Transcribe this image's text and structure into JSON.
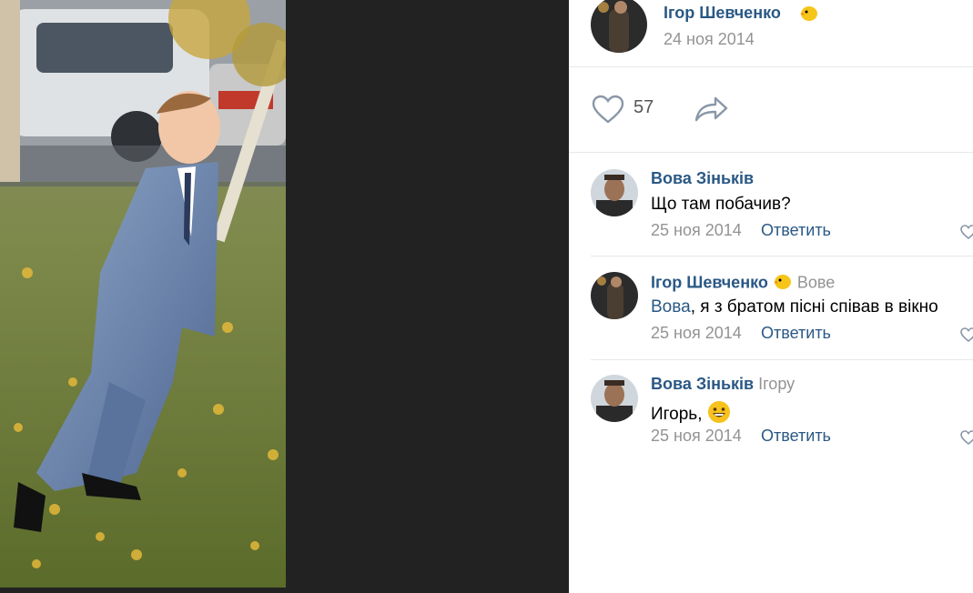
{
  "post": {
    "author": "Ігор Шевченко",
    "author_badge_icon": "chick-emoji-icon",
    "date": "24 ноя 2014",
    "likes": "57"
  },
  "comments": [
    {
      "author": "Вова Зіньків",
      "text": "Що там побачив?",
      "date": "25 ноя 2014",
      "reply_label": "Ответить"
    },
    {
      "author": "Ігор Шевченко",
      "reply_to": "Вове",
      "mention": "Вова",
      "text": ", я з братом пісні співав в вікно",
      "date": "25 ноя 2014",
      "reply_label": "Ответить"
    },
    {
      "author": "Вова Зіньків",
      "reply_to": "Ігору",
      "text": "Игорь, ",
      "emoji_icon": "grinning-face-emoji-icon",
      "date": "25 ноя 2014",
      "reply_label": "Ответить"
    }
  ],
  "colors": {
    "link": "#2a5885",
    "muted": "#939393",
    "viewer_bg": "#222222",
    "divider": "#e7e8ec"
  }
}
